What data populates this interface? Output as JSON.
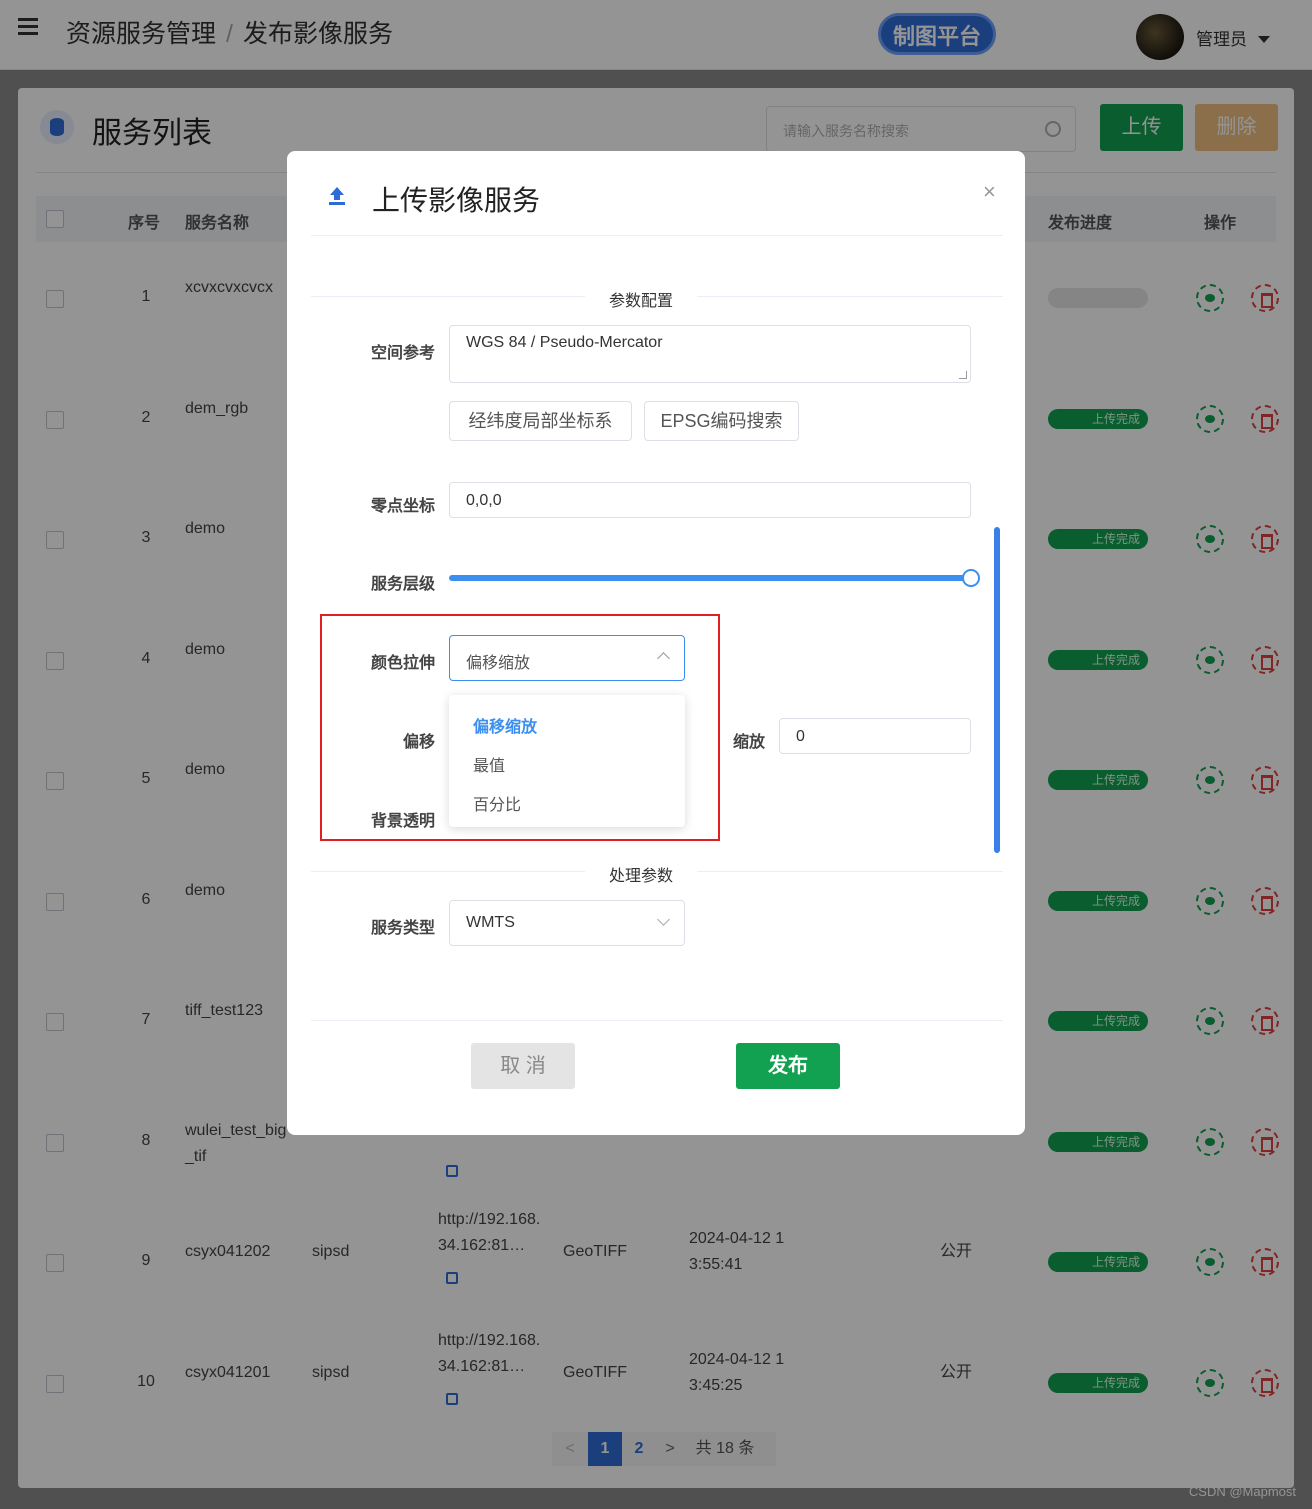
{
  "topbar": {
    "breadcrumb": [
      "资源服务管理",
      "发布影像服务"
    ],
    "breadcrumb_sep": "/",
    "map_platform": "制图平台",
    "user_name": "管理员"
  },
  "panel": {
    "title": "服务列表",
    "search_placeholder": "请输入服务名称搜索",
    "upload_label": "上传",
    "delete_label": "删除",
    "columns": [
      "序号",
      "服务名称",
      "发布进度",
      "操作"
    ],
    "rows": [
      {
        "idx": "1",
        "name": "xcvxcvxcvcx",
        "status": ""
      },
      {
        "idx": "2",
        "name": "dem_rgb",
        "status": "上传完成"
      },
      {
        "idx": "3",
        "name": "demo",
        "status": "上传完成"
      },
      {
        "idx": "4",
        "name": "demo",
        "status": "上传完成"
      },
      {
        "idx": "5",
        "name": "demo",
        "status": "上传完成"
      },
      {
        "idx": "6",
        "name": "demo",
        "status": "上传完成"
      },
      {
        "idx": "7",
        "name": "tiff_test123",
        "status": "上传完成"
      },
      {
        "idx": "8",
        "name": "wulei_test_big_tif",
        "status": "上传完成"
      },
      {
        "idx": "9",
        "name": "csyx041202",
        "status": "上传完成",
        "owner": "sipsd",
        "url": "http://192.168.34.162:81…",
        "format": "GeoTIFF",
        "time": "2024-04-12 13:55:41",
        "access": "公开"
      },
      {
        "idx": "10",
        "name": "csyx041201",
        "status": "上传完成",
        "owner": "sipsd",
        "url": "http://192.168.34.162:81…",
        "format": "GeoTIFF",
        "time": "2024-04-12 13:45:25",
        "access": "公开"
      }
    ],
    "pager": {
      "prev": "<",
      "page1": "1",
      "page2": "2",
      "next": ">",
      "total": "共 18 条"
    }
  },
  "modal": {
    "title": "上传影像服务",
    "close": "×",
    "section_params": "参数配置",
    "section_process": "处理参数",
    "spatial_ref_label": "空间参考",
    "spatial_ref_value": "WGS 84 / Pseudo-Mercator",
    "btn_local_cs": "经纬度局部坐标系",
    "btn_epsg": "EPSG编码搜索",
    "origin_label": "零点坐标",
    "origin_value": "0,0,0",
    "level_label": "服务层级",
    "level_value_fraction": 1.0,
    "stretch_label": "颜色拉伸",
    "stretch_value": "偏移缩放",
    "stretch_options": [
      "偏移缩放",
      "最值",
      "百分比"
    ],
    "offset_label": "偏移",
    "scale_label": "缩放",
    "scale_value": "0",
    "bg_label": "背景透明",
    "service_type_label": "服务类型",
    "service_type_value": "WMTS",
    "cancel_label": "取 消",
    "publish_label": "发布"
  },
  "watermark": "CSDN @Mapmost",
  "colors": {
    "primary": "#2f6bd6",
    "success": "#12a150",
    "danger": "#e02020",
    "accent": "#3b8ff0"
  }
}
